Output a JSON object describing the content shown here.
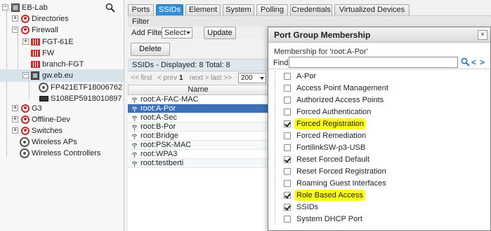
{
  "tree": {
    "items": [
      {
        "label": "EB-Lab"
      },
      {
        "label": "Directories"
      },
      {
        "label": "Firewall"
      },
      {
        "label": "FGT-61E"
      },
      {
        "label": "FW"
      },
      {
        "label": "branch-FGT"
      },
      {
        "label": "gw.eb.eu"
      },
      {
        "label": "FP421ETF18006762"
      },
      {
        "label": "S108EP5918010897"
      },
      {
        "label": "G3"
      },
      {
        "label": "Offline-Dev"
      },
      {
        "label": "Switches"
      },
      {
        "label": "Wireless APs"
      },
      {
        "label": "Wireless Controllers"
      }
    ]
  },
  "tabs": [
    "Ports",
    "SSIDs",
    "Element",
    "System",
    "Polling",
    "Credentials",
    "Virtualized Devices"
  ],
  "active_tab": "SSIDs",
  "filter": {
    "title": "Filter",
    "add_filter_label": "Add Filter:",
    "select_value": "Select",
    "update_label": "Update"
  },
  "delete_label": "Delete",
  "list_summary": "SSIDs - Displayed: 8 Total: 8",
  "pager": {
    "first": "<< first",
    "prev": "< prev",
    "page": "1",
    "next": "next >",
    "last": "last >>",
    "page_size": "200"
  },
  "column_name": "Name",
  "rows": [
    "root:A-FAC-MAC",
    "root:A-Por",
    "root:A-Sec",
    "root:B-Por",
    "root:Bridge",
    "root:PSK-MAC",
    "root:WPA3",
    "root:testberti"
  ],
  "selected_row": "root:A-Por",
  "dialog": {
    "title": "Port Group Membership",
    "close": "×",
    "membership_for": "Membership for 'root:A-Por'",
    "find_label": "Find:",
    "find_value": "",
    "prev": "<",
    "next": ">",
    "items": [
      {
        "label": "A-Por",
        "checked": false,
        "highlight": false
      },
      {
        "label": "Access Point Management",
        "checked": false,
        "highlight": false
      },
      {
        "label": "Authorized Access Points",
        "checked": false,
        "highlight": false
      },
      {
        "label": "Forced Authentication",
        "checked": false,
        "highlight": false
      },
      {
        "label": "Forced Registration",
        "checked": true,
        "highlight": true
      },
      {
        "label": "Forced Remediation",
        "checked": false,
        "highlight": false
      },
      {
        "label": "FortilinkSW-p3-USB",
        "checked": false,
        "highlight": false
      },
      {
        "label": "Reset Forced Default",
        "checked": true,
        "highlight": false
      },
      {
        "label": "Reset Forced Registration",
        "checked": false,
        "highlight": false
      },
      {
        "label": "Roaming Guest Interfaces",
        "checked": false,
        "highlight": false
      },
      {
        "label": "Role Based Access",
        "checked": true,
        "highlight": true
      },
      {
        "label": "SSIDs",
        "checked": true,
        "highlight": false
      },
      {
        "label": "System DHCP Port",
        "checked": false,
        "highlight": false
      }
    ]
  },
  "colors": {
    "active_tab": "#2f8fd6",
    "selected_row": "#3b6fb6",
    "highlight": "#ffff1a",
    "tree_icon_red": "#c22a2a"
  }
}
